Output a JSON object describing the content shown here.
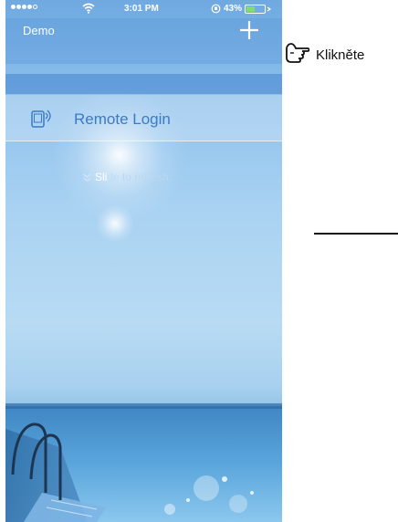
{
  "status_bar": {
    "time": "3:01 PM",
    "battery": "43%"
  },
  "nav": {
    "title": "Demo",
    "add_icon": "plus-icon"
  },
  "list": {
    "items": [
      {
        "label": "Remote Login",
        "icon": "remote-device-icon"
      }
    ]
  },
  "refresh_hint": {
    "prefix": "Sli",
    "faded": "de",
    "suffix": " to refresh."
  },
  "annotation": {
    "text": "Klikněte",
    "icon": "pointing-hand-icon"
  },
  "colors": {
    "accent": "#3a7bc8",
    "nav_text": "#ffffff"
  }
}
